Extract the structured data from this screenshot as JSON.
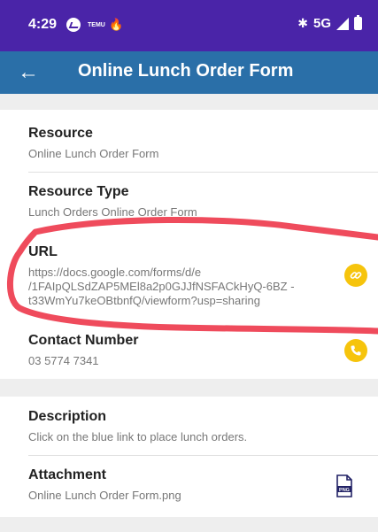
{
  "status_bar": {
    "time": "4:29",
    "temu_text": "TEMU",
    "network": "5G"
  },
  "app_bar": {
    "back_icon": "arrow-back-icon",
    "title": "Online Lunch Order Form"
  },
  "details": {
    "resource": {
      "label": "Resource",
      "value": "Online Lunch Order Form"
    },
    "resource_type": {
      "label": "Resource Type",
      "value": "Lunch Orders Online Order Form"
    },
    "url": {
      "label": "URL",
      "value": "https://docs.google.com/forms/d/e /1FAIpQLSdZAP5MEl8a2p0GJJfNSFACkHyQ-6BZ -t33WmYu7keOBtbnfQ/viewform?usp=sharing",
      "icon": "link-icon"
    },
    "contact": {
      "label": "Contact Number",
      "value": "03 5774 7341",
      "icon": "phone-icon"
    }
  },
  "extra": {
    "description": {
      "label": "Description",
      "value": "Click on the blue link to place lunch orders."
    },
    "attachment": {
      "label": "Attachment",
      "value": "Online Lunch Order Form.png",
      "icon": "png-file-icon",
      "badge": "PNG"
    }
  },
  "colors": {
    "status_bar": "#4a24a8",
    "app_bar": "#2a6fa8",
    "action_icon": "#f6c40c",
    "annotation": "#ef4b5c"
  }
}
